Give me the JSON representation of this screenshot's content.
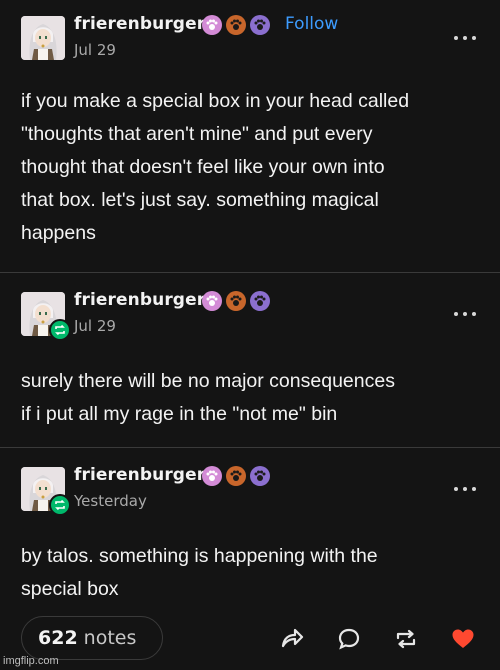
{
  "posts": [
    {
      "username": "frierenburger",
      "follow_label": "Follow",
      "date": "Jul 29",
      "body": [
        "if you make a special box in your head called",
        "\"thoughts that aren't mine\" and put every",
        "thought that doesn't feel like your own into",
        "that box. let's just say. something magical",
        "happens"
      ],
      "reblogged": false,
      "avatar_icon": "anime-character-avatar",
      "badges": [
        {
          "icon": "paw-badge-icon",
          "color": "#d38bd6"
        },
        {
          "icon": "paw-badge-icon",
          "color": "#c8662b"
        },
        {
          "icon": "paw-badge-icon",
          "color": "#8b6fcf"
        }
      ]
    },
    {
      "username": "frierenburger",
      "date": "Jul 29",
      "body": [
        "surely there will be no major consequences",
        "if i put all my rage in the \"not me\" bin"
      ],
      "reblogged": true,
      "avatar_icon": "anime-character-avatar",
      "badges": [
        {
          "icon": "paw-badge-icon",
          "color": "#d38bd6"
        },
        {
          "icon": "paw-badge-icon",
          "color": "#c8662b"
        },
        {
          "icon": "paw-badge-icon",
          "color": "#8b6fcf"
        }
      ]
    },
    {
      "username": "frierenburger",
      "date": "Yesterday",
      "body": [
        "by talos. something is happening with the",
        "special box"
      ],
      "reblogged": true,
      "avatar_icon": "anime-character-avatar",
      "badges": [
        {
          "icon": "paw-badge-icon",
          "color": "#d38bd6"
        },
        {
          "icon": "paw-badge-icon",
          "color": "#c8662b"
        },
        {
          "icon": "paw-badge-icon",
          "color": "#8b6fcf"
        }
      ]
    }
  ],
  "footer": {
    "notes_count": "622",
    "notes_label": "notes",
    "actions": [
      "share-icon",
      "reply-icon",
      "reblog-icon",
      "like-icon"
    ],
    "like_color": "#ff4930"
  },
  "watermark": "imgflip.com",
  "colors": {
    "background": "#141414",
    "follow": "#3d9cff",
    "reblog_badge": "#00b86b"
  }
}
